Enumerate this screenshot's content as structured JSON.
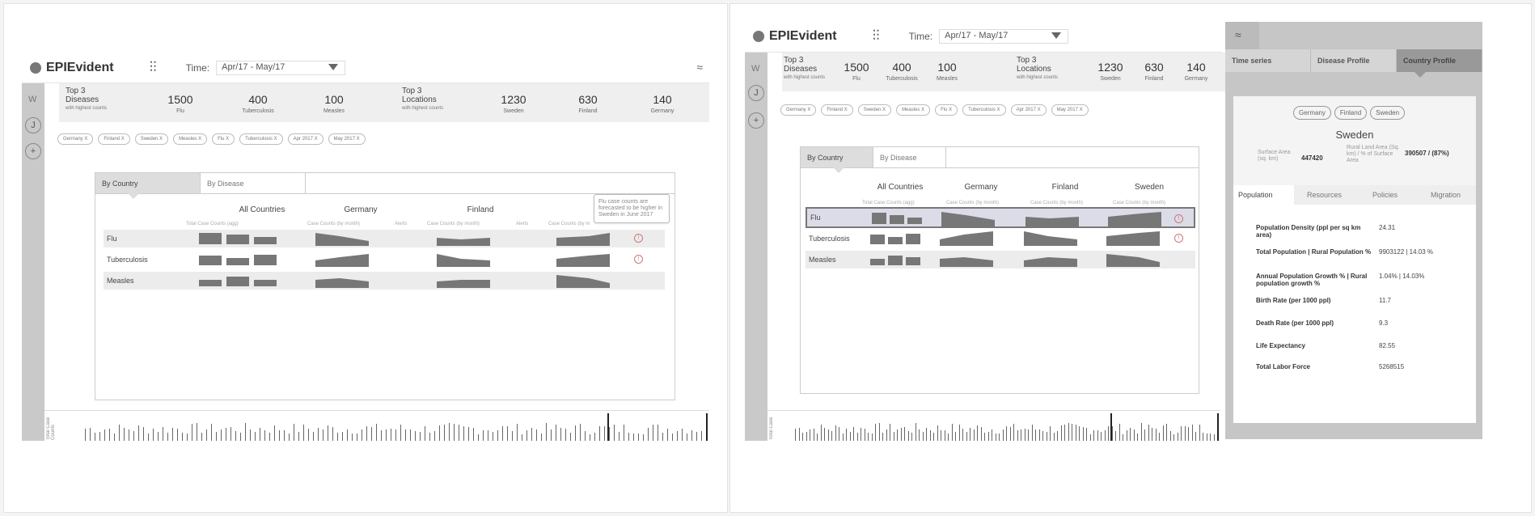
{
  "app": {
    "name": "EPIEvident",
    "time_label": "Time:",
    "time_value": "Apr/17 - May/17"
  },
  "sidebar": {
    "letter": "W",
    "profile_letter": "J",
    "add": "+"
  },
  "stats": {
    "diseases": {
      "title_lines": [
        "Top 3",
        "Diseases"
      ],
      "subtitle": "with highest counts",
      "items": [
        {
          "value": "1500",
          "label": "Flu"
        },
        {
          "value": "400",
          "label": "Tuberculosis"
        },
        {
          "value": "100",
          "label": "Measles"
        }
      ]
    },
    "locations": {
      "title_lines": [
        "Top 3",
        "Locations"
      ],
      "subtitle": "with highest counts",
      "items": [
        {
          "value": "1230",
          "label": "Sweden"
        },
        {
          "value": "630",
          "label": "Finland"
        },
        {
          "value": "140",
          "label": "Germany"
        }
      ]
    }
  },
  "chips": [
    "Germany X",
    "Finland X",
    "Sweden X",
    "Measles X",
    "Flu X",
    "Tuberculosis X",
    "Apr 2017 X",
    "May 2017 X"
  ],
  "main_tabs": [
    "By Country",
    "By Disease"
  ],
  "left_table": {
    "columns": [
      {
        "title": "All Countries",
        "sub": "Total Case Counts (agg)"
      },
      {
        "title": "Germany",
        "sub": "Case Counts (by month)"
      },
      {
        "title": "Finland",
        "sub": "Case Counts (by month)"
      }
    ],
    "alerts_label": "Alerts",
    "extra_sub": "Case Counts (by m",
    "rows": [
      "Flu",
      "Tuberculosis",
      "Measles"
    ],
    "alert_glyph": "!"
  },
  "tooltip": "Flu case counts are forecasted to be higher in Sweden in June 2017",
  "right_table": {
    "columns": [
      {
        "title": "All Countries",
        "sub": "Total Case Counts (agg)"
      },
      {
        "title": "Germany",
        "sub": "Case Counts (by month)"
      },
      {
        "title": "Finland",
        "sub": "Case Counts (by month)"
      },
      {
        "title": "Sweden",
        "sub": "Case Counts (by month)"
      }
    ],
    "rows": [
      "Flu",
      "Tuberculosis",
      "Measles"
    ]
  },
  "timeline_label": "Total Case Counts",
  "timeline_label_short": "Total Case",
  "profile": {
    "tabs": [
      "Time series",
      "Disease Profile",
      "Country Profile"
    ],
    "chips": [
      "Germany",
      "Finland",
      "Sweden"
    ],
    "country": "Sweden",
    "surface_area_label": "Surface Area (sq. km)",
    "surface_area_value": "447420",
    "rural_land_label": "Rural Land Area (Sq. km) / % of Surface Area",
    "rural_land_value": "390507 / (87%)",
    "subtabs": [
      "Population",
      "Resources",
      "Policies",
      "Migration"
    ],
    "kv": [
      {
        "k": "Population Density (ppl per sq km area)",
        "v": "24.31"
      },
      {
        "k": "Total Population | Rural Population %",
        "v": "9903122 | 14.03 %"
      },
      {
        "k": "Annual Population Growth % | Rural population growth %",
        "v": "1.04% | 14.03%"
      },
      {
        "k": "Birth Rate (per 1000 ppl)",
        "v": "11.7"
      },
      {
        "k": "Death Rate (per 1000 ppl)",
        "v": "9.3"
      },
      {
        "k": "Life Expectancy",
        "v": "82.55"
      },
      {
        "k": "Total Labor Force",
        "v": "5268515"
      }
    ]
  }
}
